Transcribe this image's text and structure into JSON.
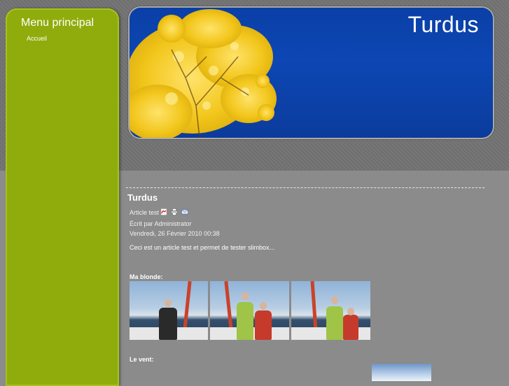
{
  "site": {
    "title": "Turdus"
  },
  "sidebar": {
    "title": "Menu principal",
    "items": [
      {
        "label": "Accueil"
      }
    ]
  },
  "article": {
    "heading": "Turdus",
    "title": "Article test",
    "author": "Écrit par Administrator",
    "date": "Vendredi, 26 Février 2010 00:38",
    "body": "Ceci est un article test et permet de tester slimbox...",
    "sections": [
      {
        "label": "Ma blonde:"
      },
      {
        "label": "Le vent:"
      }
    ],
    "icons": [
      "pdf-icon",
      "print-icon",
      "email-icon"
    ]
  },
  "colors": {
    "sidebar": "#8fac0c",
    "banner": "#0d47b4",
    "background": "#8c8c8c"
  }
}
